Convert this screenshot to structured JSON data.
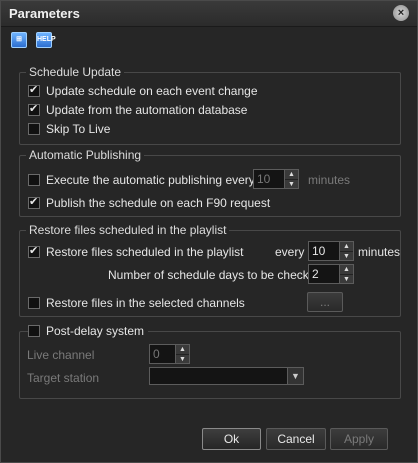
{
  "window": {
    "title": "Parameters",
    "close": "×"
  },
  "toolbar": {
    "icon1": "⊞",
    "icon2": "HELP"
  },
  "schedule_update": {
    "title": "Schedule Update",
    "opt1": "Update schedule on each event change",
    "opt2": "Update from the automation database",
    "opt3": "Skip To Live"
  },
  "auto_publishing": {
    "title": "Automatic Publishing",
    "execute_label": "Execute the automatic publishing every:",
    "execute_value": "10",
    "execute_unit": "minutes",
    "publish_label": "Publish the schedule on each F90 request"
  },
  "restore": {
    "title": "Restore files scheduled in the playlist",
    "restore_label": "Restore files scheduled in the playlist",
    "every_label": "every",
    "every_value": "10",
    "every_unit": "minutes",
    "days_label": "Number of schedule days to be checked",
    "days_value": "2",
    "channels_label": "Restore files in the selected channels",
    "browse_label": "..."
  },
  "post_delay": {
    "title": "Post-delay system",
    "live_channel_label": "Live channel",
    "live_channel_value": "0",
    "target_station_label": "Target station",
    "target_station_value": ""
  },
  "buttons": {
    "ok": "Ok",
    "cancel": "Cancel",
    "apply": "Apply"
  }
}
